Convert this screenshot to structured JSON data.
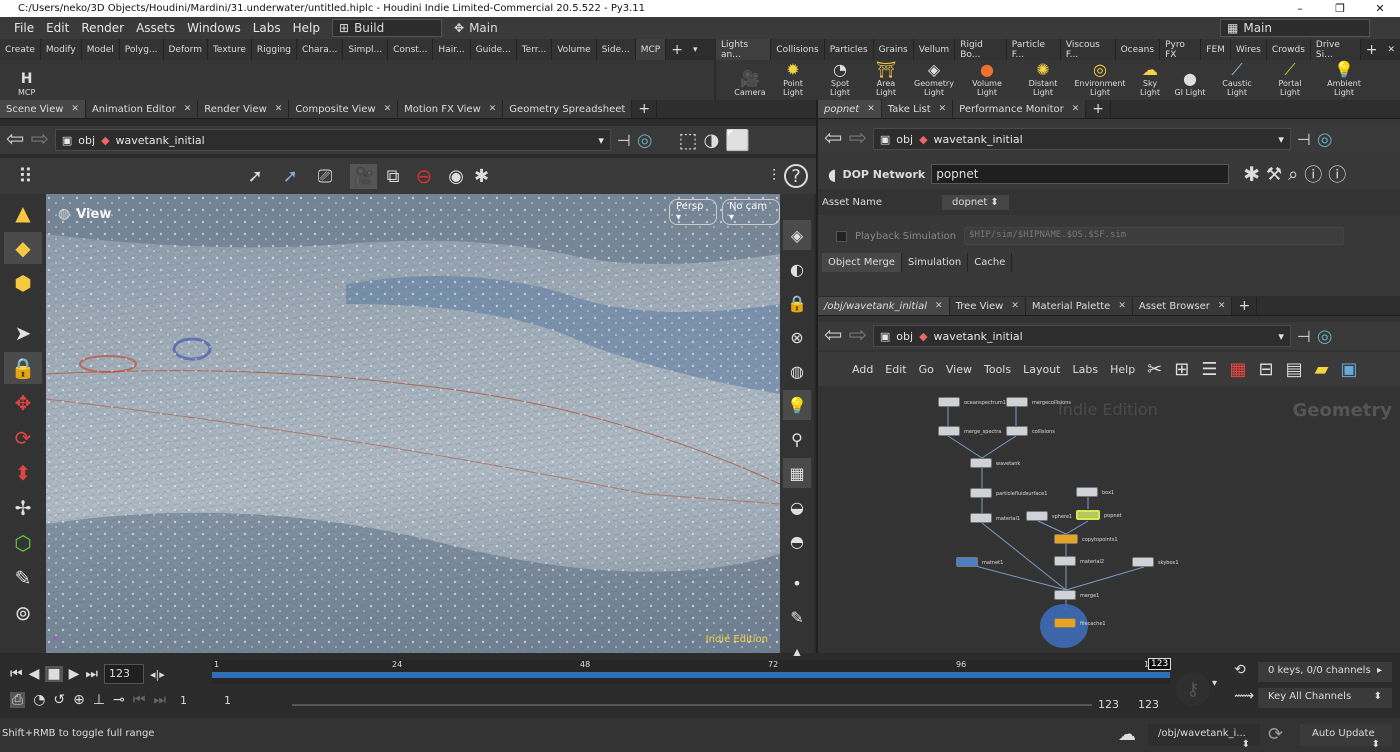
{
  "window": {
    "title": "C:/Users/neko/3D Objects/Houdini/Mardini/31.underwater/untitled.hiplc - Houdini Indie Limited-Commercial 20.5.522 - Py3.11",
    "minimize": "–",
    "maximize": "❐",
    "close": "✕"
  },
  "menu": {
    "items": [
      "File",
      "Edit",
      "Render",
      "Assets",
      "Windows",
      "Labs",
      "Help"
    ],
    "build": "Build",
    "desktop": "Main",
    "right_desktop": "Main"
  },
  "shelf_left": {
    "tabs": [
      "Create",
      "Modify",
      "Model",
      "Polyg...",
      "Deform",
      "Texture",
      "Rigging",
      "Chara...",
      "Simpl...",
      "Const...",
      "Hair...",
      "Guide...",
      "Terr...",
      "Volume",
      "Side...",
      "MCP"
    ],
    "active": "MCP",
    "tool": "MCP"
  },
  "shelf_right": {
    "tabs": [
      "Lights an...",
      "Collisions",
      "Particles",
      "Grains",
      "Vellum",
      "Rigid Bo...",
      "Particle F...",
      "Viscous F...",
      "Oceans",
      "Pyro FX",
      "FEM",
      "Wires",
      "Crowds",
      "Drive Si..."
    ],
    "tools": [
      "Camera",
      "Point Light",
      "Spot Light",
      "Area Light",
      "Geometry Light",
      "Volume Light",
      "Distant Light",
      "Environment Light",
      "Sky Light",
      "GI Light",
      "Caustic Light",
      "Portal Light",
      "Ambient Light"
    ]
  },
  "left_pane": {
    "tabs": [
      "Scene View",
      "Animation Editor",
      "Render View",
      "Composite View",
      "Motion FX View",
      "Geometry Spreadsheet"
    ],
    "path_root": "obj",
    "path_node": "wavetank_initial"
  },
  "viewport": {
    "label": "View",
    "persp": "Persp",
    "cam": "No cam",
    "watermark": "Indie Edition"
  },
  "param_pane": {
    "tabs": [
      "popnet",
      "Take List",
      "Performance Monitor"
    ],
    "path_root": "obj",
    "path_node": "wavetank_initial",
    "node_type": "DOP Network",
    "node_name": "popnet",
    "asset_label": "Asset Name",
    "asset_value": "dopnet",
    "playback_label": "Playback Simulation",
    "playback_path": "$HIP/sim/$HIPNAME.$OS.$SF.sim",
    "subtabs": [
      "Object Merge",
      "Simulation",
      "Cache"
    ]
  },
  "network_pane": {
    "tabs": [
      "/obj/wavetank_initial",
      "Tree View",
      "Material Palette",
      "Asset Browser"
    ],
    "path_root": "obj",
    "path_node": "wavetank_initial",
    "menu": [
      "Add",
      "Edit",
      "Go",
      "View",
      "Tools",
      "Layout",
      "Labs",
      "Help"
    ],
    "watermark": "Indie Edition",
    "context": "Geometry",
    "nodes": [
      "oceanspectrum1",
      "mergecollisions",
      "merge_spectra",
      "collisions",
      "wavetank",
      "particlefluidsurface1",
      "box1",
      "material1",
      "sphere1",
      "popnet",
      "copytopoints1",
      "material2",
      "matnet1",
      "skybox1",
      "merge1",
      "filecache1"
    ]
  },
  "timeline": {
    "ticks": [
      "1",
      "24",
      "48",
      "72",
      "96",
      "1"
    ],
    "frame": "123",
    "current": "123",
    "start": "1",
    "start2": "1",
    "end": "123",
    "end2": "123",
    "keys": "0 keys, 0/0 channels",
    "key_mode": "Key All Channels"
  },
  "status": {
    "hint": "Shift+RMB to toggle full range",
    "path": "/obj/wavetank_i...",
    "update": "Auto Update"
  }
}
